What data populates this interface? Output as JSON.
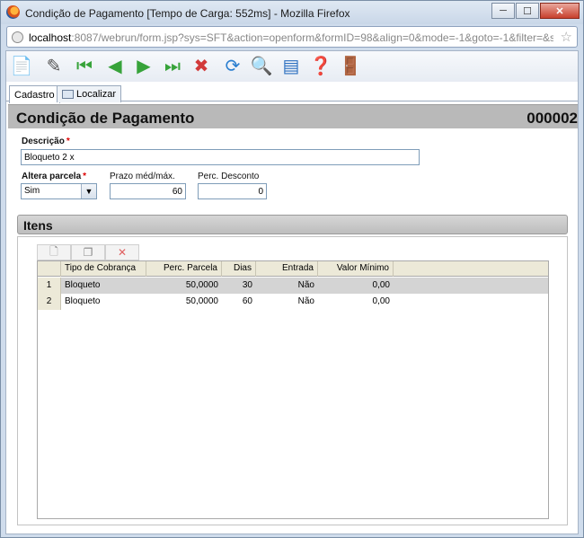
{
  "window": {
    "title": "Condição de Pagamento [Tempo de Carga: 552ms] - Mozilla Firefox",
    "url_host": "localhost",
    "url_rest": ":8087/webrun/form.jsp?sys=SFT&action=openform&formID=98&align=0&mode=-1&goto=-1&filter=&sc"
  },
  "toolbar_icons": [
    "new-record-icon",
    "edit-icon",
    "first-record-icon",
    "previous-record-icon",
    "next-record-icon",
    "last-record-icon",
    "delete-icon",
    "refresh-icon",
    "search-icon",
    "report-icon",
    "help-icon",
    "exit-icon"
  ],
  "tabs": [
    {
      "label": "Cadastro"
    },
    {
      "label": "Localizar"
    }
  ],
  "form": {
    "title": "Condição de Pagamento",
    "code": "000002",
    "descricao": {
      "label": "Descrição",
      "value": "Bloqueto 2 x"
    },
    "altera_parcela": {
      "label": "Altera parcela",
      "value": "Sim"
    },
    "prazo": {
      "label": "Prazo méd/máx.",
      "value": "60"
    },
    "desconto": {
      "label": "Perc. Desconto",
      "value": "0"
    }
  },
  "itens": {
    "title": "Itens",
    "columns": [
      "Tipo de Cobrança",
      "Perc. Parcela",
      "Dias",
      "Entrada",
      "Valor Mínimo"
    ],
    "rows": [
      {
        "n": "1",
        "tipo": "Bloqueto",
        "perc": "50,0000",
        "dias": "30",
        "entrada": "Não",
        "valor": "0,00"
      },
      {
        "n": "2",
        "tipo": "Bloqueto",
        "perc": "50,0000",
        "dias": "60",
        "entrada": "Não",
        "valor": "0,00"
      }
    ]
  }
}
